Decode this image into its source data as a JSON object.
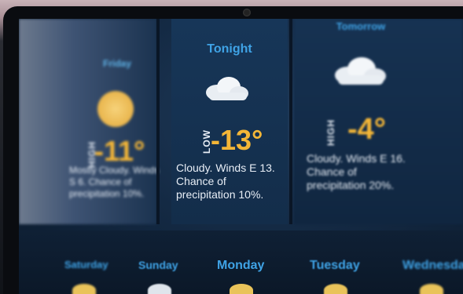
{
  "left_panel": {
    "title": "Friday",
    "temp": "-11°",
    "tag": "HIGH",
    "desc": "Mostly Cloudy. Winds\nS 6. Chance of\nprecipitation 10%."
  },
  "mid_panel": {
    "title": "Tonight",
    "tag": "LOW",
    "temp": "-13°",
    "desc": "Cloudy.  Winds E 13.\nChance of\nprecipitation 10%."
  },
  "right_panel": {
    "title": "Tomorrow",
    "tag": "HIGH",
    "temp": "-4°",
    "desc": "Cloudy.  Winds E 16.\nChance of\nprecipitation 20%."
  },
  "days": [
    "Saturday",
    "Sunday",
    "Monday",
    "Tuesday",
    "Wednesday"
  ],
  "colors": {
    "accent_blue": "#3fa3e6",
    "temp_orange": "#f4b637",
    "text_light": "#e8eef6",
    "screen_bg": "#142a44"
  },
  "icons": [
    "cloud-icon",
    "sun-icon"
  ]
}
